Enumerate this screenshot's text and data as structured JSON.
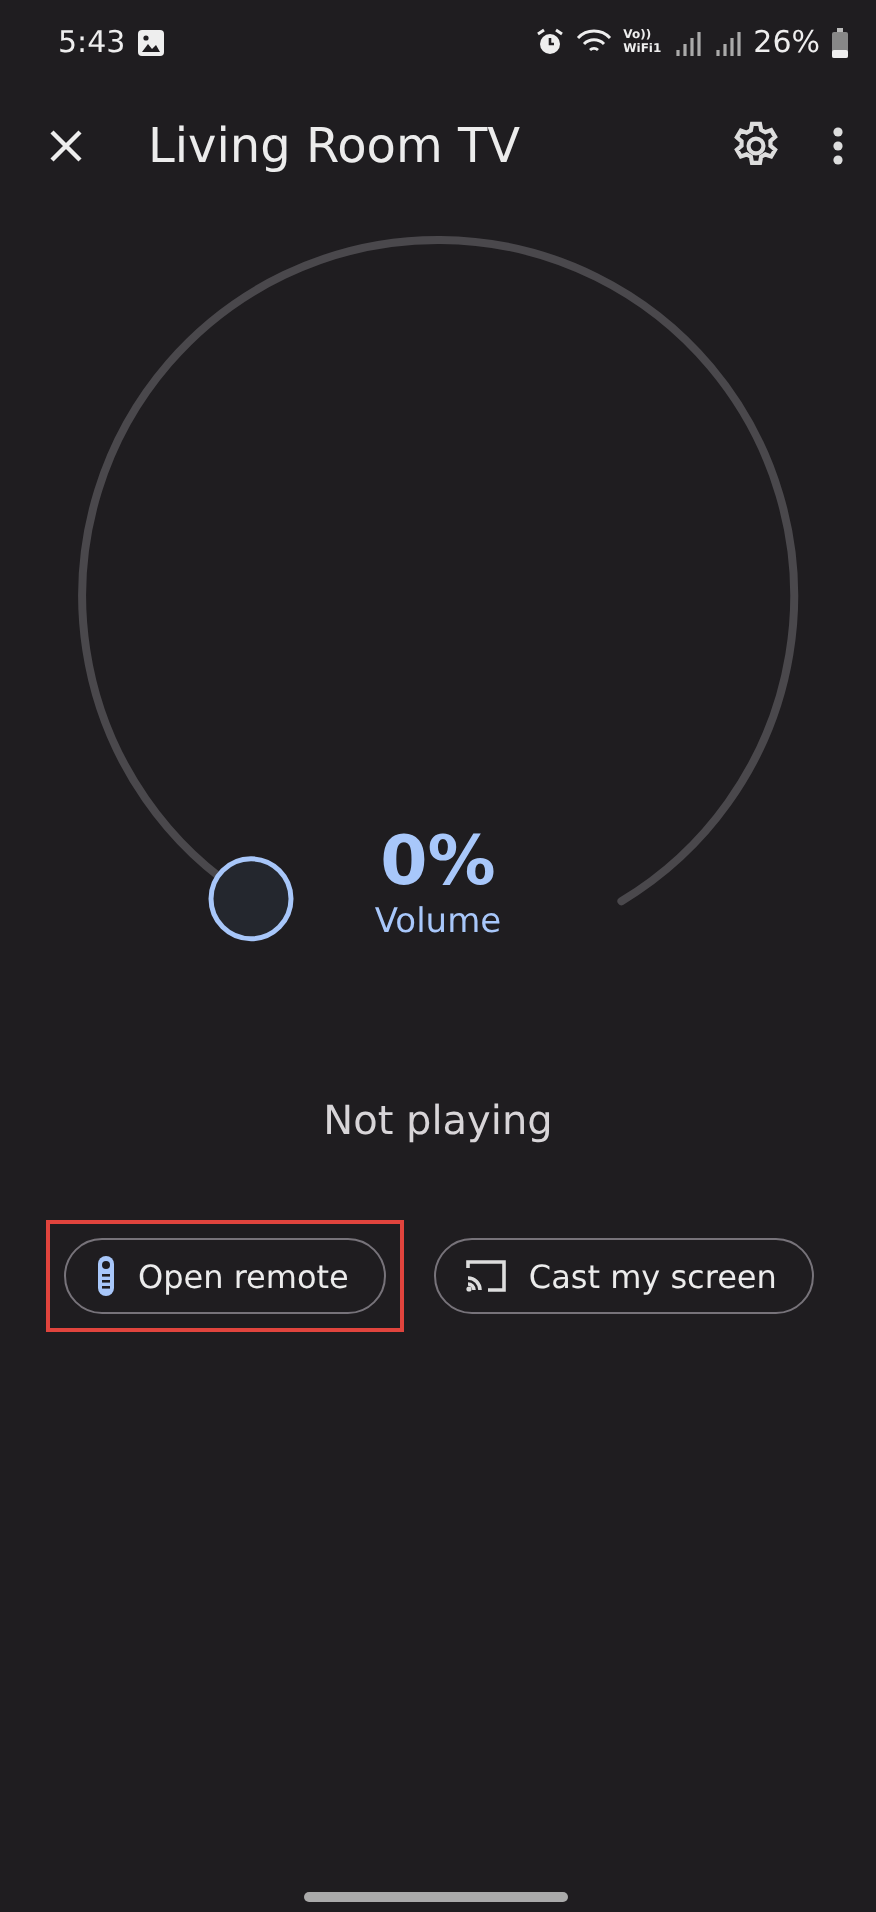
{
  "status_bar": {
    "time": "5:43",
    "wifi_calling": [
      "Vo))",
      "WiFi1"
    ],
    "battery": "26%"
  },
  "toolbar": {
    "title": "Living Room TV"
  },
  "volume": {
    "reading": "0%",
    "label": "Volume"
  },
  "playback_status": "Not playing",
  "buttons": [
    {
      "kind": "remote",
      "label": "Open remote",
      "highlighted": true
    },
    {
      "kind": "cast",
      "label": "Cast my screen",
      "highlighted": false
    }
  ]
}
